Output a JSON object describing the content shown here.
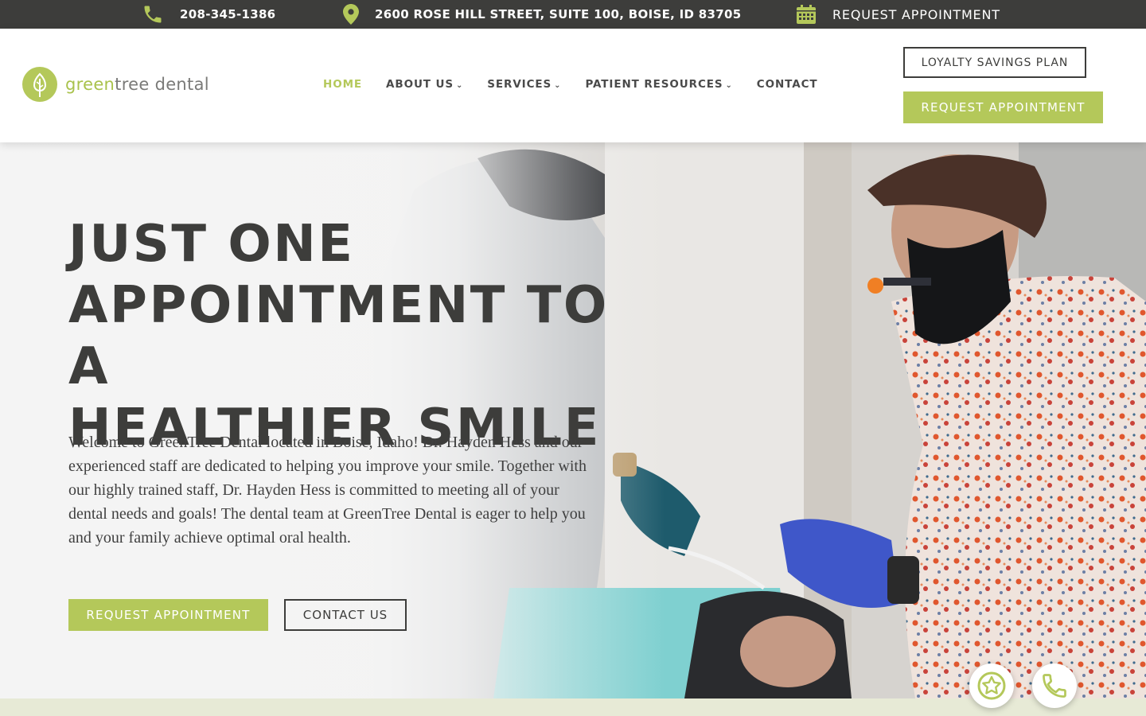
{
  "topbar": {
    "phone": "208-345-1386",
    "address": "2600 ROSE HILL STREET, SUITE 100, BOISE, ID 83705",
    "appointment": "REQUEST APPOINTMENT",
    "icons": [
      "phone-icon",
      "map-pin-icon",
      "calendar-icon"
    ]
  },
  "logo": {
    "part1": "green",
    "part2": "tree dental"
  },
  "nav": {
    "items": [
      {
        "label": "HOME",
        "active": true
      },
      {
        "label": "ABOUT US",
        "caret": "⌄"
      },
      {
        "label": "SERVICES",
        "caret": "⌄"
      },
      {
        "label": "PATIENT RESOURCES",
        "caret": "⌄"
      },
      {
        "label": "CONTACT"
      }
    ]
  },
  "header_buttons": {
    "loyalty": "LOYALTY SAVINGS PLAN",
    "request": "REQUEST APPOINTMENT"
  },
  "hero": {
    "title_lines": [
      "JUST ONE",
      "APPOINTMENT TO A",
      "HEALTHIER SMILE"
    ],
    "body": "Welcome to GreenTree Dental located in Boise, Idaho! Dr. Hayden Hess and our experienced staff are dedicated to helping you improve your smile. Together with our highly trained staff, Dr. Hayden Hess is committed to meeting all of your dental needs and goals! The dental team at GreenTree Dental is eager to help you and your family achieve optimal oral health.",
    "primary_button": "REQUEST APPOINTMENT",
    "secondary_button": "CONTACT US"
  },
  "floating": {
    "icons": [
      "review-star-icon",
      "phone-icon"
    ]
  },
  "colors": {
    "brand_green": "#b4c85a",
    "dark": "#3d3d3b",
    "strip": "#e7ead6"
  }
}
